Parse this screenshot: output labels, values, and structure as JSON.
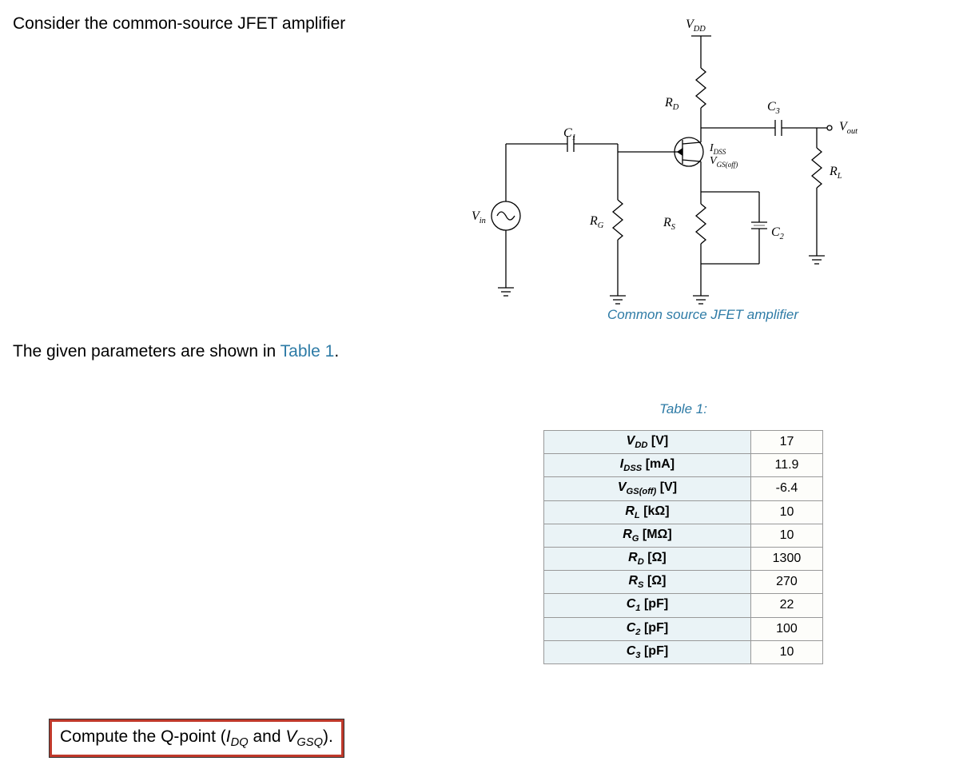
{
  "intro": "Consider the common-source JFET amplifier",
  "parameters_text_prefix": "The given parameters are shown in ",
  "parameters_text_link": "Table 1",
  "parameters_text_suffix": ".",
  "circuit": {
    "caption": "Common source JFET amplifier",
    "labels": {
      "vdd": "V",
      "vdd_sub": "DD",
      "rd": "R",
      "rd_sub": "D",
      "c3": "C",
      "c3_sub": "3",
      "vout": "V",
      "vout_sub": "out",
      "c1": "C",
      "c1_sub": "1",
      "idss": "I",
      "idss_sub": "DSS",
      "vgsoff": "V",
      "vgsoff_sub": "GS(off)",
      "rl": "R",
      "rl_sub": "L",
      "vin": "V",
      "vin_sub": "in",
      "rg": "R",
      "rg_sub": "G",
      "rs": "R",
      "rs_sub": "S",
      "c2": "C",
      "c2_sub": "2"
    }
  },
  "table": {
    "title": "Table 1:",
    "rows": [
      {
        "param_main": "V",
        "param_sub": "DD",
        "unit": " [V]",
        "value": "17"
      },
      {
        "param_main": "I",
        "param_sub": "DSS",
        "unit": " [mA]",
        "value": "11.9"
      },
      {
        "param_main": "V",
        "param_sub": "GS(off)",
        "unit": " [V]",
        "value": "-6.4"
      },
      {
        "param_main": "R",
        "param_sub": "L",
        "unit": " [kΩ]",
        "value": "10"
      },
      {
        "param_main": "R",
        "param_sub": "G",
        "unit": " [MΩ]",
        "value": "10"
      },
      {
        "param_main": "R",
        "param_sub": "D",
        "unit": " [Ω]",
        "value": "1300"
      },
      {
        "param_main": "R",
        "param_sub": "S",
        "unit": " [Ω]",
        "value": "270"
      },
      {
        "param_main": "C",
        "param_sub": "1",
        "unit": " [pF]",
        "value": "22"
      },
      {
        "param_main": "C",
        "param_sub": "2",
        "unit": " [pF]",
        "value": "100"
      },
      {
        "param_main": "C",
        "param_sub": "3",
        "unit": " [pF]",
        "value": "10"
      }
    ]
  },
  "question": {
    "prefix": "Compute the Q-point (",
    "i_main": "I",
    "i_sub": "DQ",
    "mid": " and ",
    "v_main": "V",
    "v_sub": "GSQ",
    "suffix": ")."
  }
}
